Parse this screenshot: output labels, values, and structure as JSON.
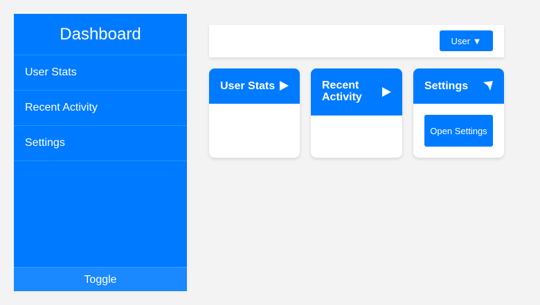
{
  "sidebar": {
    "title": "Dashboard",
    "items": [
      {
        "label": "User Stats"
      },
      {
        "label": "Recent Activity"
      },
      {
        "label": "Settings"
      }
    ],
    "toggle_label": "Toggle"
  },
  "topbar": {
    "user_button_label": "User ▼"
  },
  "cards": [
    {
      "title": "User Stats",
      "icon": "play-icon"
    },
    {
      "title": "Recent Activity",
      "icon": "play-icon"
    },
    {
      "title": "Settings",
      "icon": "cursor-arrow-icon",
      "button_label": "Open Settings"
    }
  ],
  "colors": {
    "accent": "#007bff",
    "background": "#f3f3f3",
    "toggle": "#1a88ff"
  }
}
